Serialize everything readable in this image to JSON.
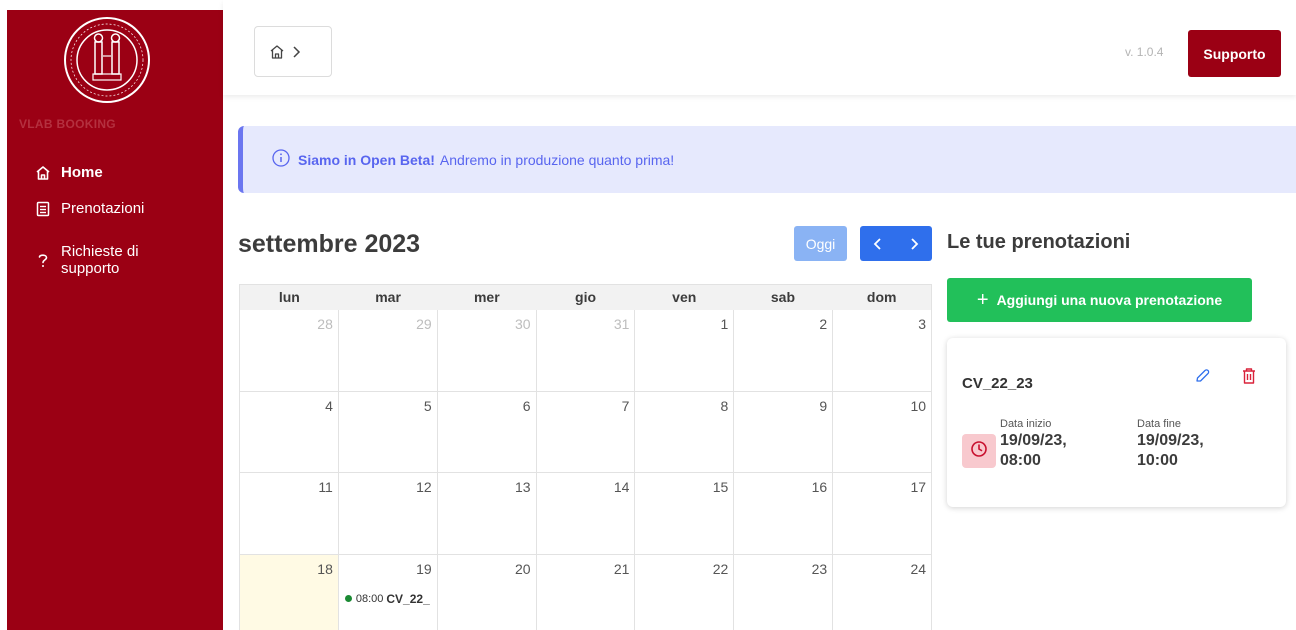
{
  "sidebar": {
    "app_name": "VLAB BOOKING",
    "nav": [
      {
        "label": "Home",
        "icon": "home-icon",
        "active": true
      },
      {
        "label": "Prenotazioni",
        "icon": "document-icon"
      },
      {
        "label_line1": "Richieste di",
        "label_line2": "supporto",
        "icon": "question-icon"
      }
    ]
  },
  "header": {
    "version": "v. 1.0.4",
    "support_label": "Supporto"
  },
  "alert": {
    "bold": "Siamo in Open Beta!",
    "text": "Andremo in produzione quanto prima!"
  },
  "calendar": {
    "month_title": "settembre 2023",
    "today_label": "Oggi",
    "weekdays": [
      "lun",
      "mar",
      "mer",
      "gio",
      "ven",
      "sab",
      "dom"
    ],
    "weeks": [
      [
        "28",
        "29",
        "30",
        "31",
        "1",
        "2",
        "3"
      ],
      [
        "4",
        "5",
        "6",
        "7",
        "8",
        "9",
        "10"
      ],
      [
        "11",
        "12",
        "13",
        "14",
        "15",
        "16",
        "17"
      ],
      [
        "18",
        "19",
        "20",
        "21",
        "22",
        "23",
        "24"
      ]
    ],
    "event": {
      "time": "08:00",
      "title": "CV_22_"
    }
  },
  "bookings": {
    "title": "Le tue prenotazioni",
    "add_label": "Aggiungi una nuova prenotazione",
    "card": {
      "name": "CV_22_23",
      "start_label": "Data inizio",
      "start_date": "19/09/23,",
      "start_time": "08:00",
      "end_label": "Data fine",
      "end_date": "19/09/23,",
      "end_time": "10:00"
    }
  },
  "colors": {
    "brand": "#9b0014",
    "primary": "#2f6fec",
    "success": "#22c05a",
    "alert": "#5865ef"
  }
}
